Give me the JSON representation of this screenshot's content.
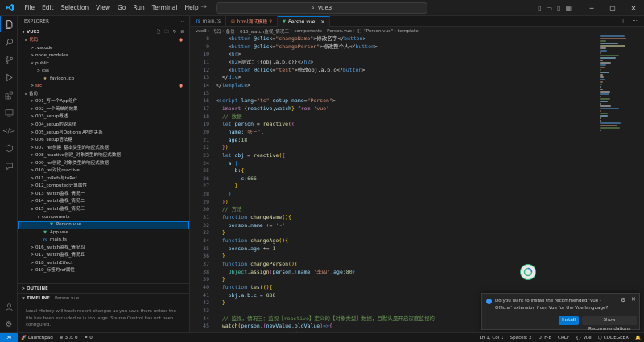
{
  "menu": [
    "File",
    "Edit",
    "Selection",
    "View",
    "Go",
    "Run",
    "Terminal",
    "Help"
  ],
  "search": {
    "text": "Vue3"
  },
  "sidebar": {
    "header": "EXPLORER",
    "root": "VUE3",
    "items": [
      {
        "label": "代码",
        "depth": 1,
        "chev": "v",
        "icon": "",
        "red": true
      },
      {
        "label": ".vscode",
        "depth": 2,
        "chev": ">",
        "icon": ""
      },
      {
        "label": "node_modules",
        "depth": 2,
        "chev": ">",
        "icon": ""
      },
      {
        "label": "public",
        "depth": 2,
        "chev": "v",
        "icon": ""
      },
      {
        "label": "css",
        "depth": 3,
        "chev": ">",
        "icon": ""
      },
      {
        "label": "favicon.ico",
        "depth": 3,
        "chev": "",
        "icon": "ico"
      },
      {
        "label": "src",
        "depth": 2,
        "chev": ">",
        "icon": "",
        "red": true
      },
      {
        "label": "备份",
        "depth": 1,
        "chev": "v",
        "icon": ""
      },
      {
        "label": "001_写一个App组件",
        "depth": 2,
        "chev": ">",
        "icon": ""
      },
      {
        "label": "002_一个简单的效果",
        "depth": 2,
        "chev": ">",
        "icon": ""
      },
      {
        "label": "003_setup概述",
        "depth": 2,
        "chev": ">",
        "icon": ""
      },
      {
        "label": "004_setup的返回值",
        "depth": 2,
        "chev": ">",
        "icon": ""
      },
      {
        "label": "005_setup与Options API的关系",
        "depth": 2,
        "chev": ">",
        "icon": ""
      },
      {
        "label": "006_setup语法糖",
        "depth": 2,
        "chev": ">",
        "icon": ""
      },
      {
        "label": "007_ref创建_基本类型的响应式数据",
        "depth": 2,
        "chev": ">",
        "icon": ""
      },
      {
        "label": "008_reactive创建_对象类型的响应式数据",
        "depth": 2,
        "chev": ">",
        "icon": ""
      },
      {
        "label": "009_ref创建_对象类型的响应式数据",
        "depth": 2,
        "chev": ">",
        "icon": ""
      },
      {
        "label": "010_ref对比reactive",
        "depth": 2,
        "chev": ">",
        "icon": ""
      },
      {
        "label": "011_toRefs与toRef",
        "depth": 2,
        "chev": ">",
        "icon": ""
      },
      {
        "label": "012_computed计算属性",
        "depth": 2,
        "chev": ">",
        "icon": ""
      },
      {
        "label": "013_watch监视_情况一",
        "depth": 2,
        "chev": ">",
        "icon": ""
      },
      {
        "label": "014_watch监视_情况二",
        "depth": 2,
        "chev": ">",
        "icon": ""
      },
      {
        "label": "015_watch监视_情况三",
        "depth": 2,
        "chev": "v",
        "icon": ""
      },
      {
        "label": "components",
        "depth": 3,
        "chev": "v",
        "icon": ""
      },
      {
        "label": "Person.vue",
        "depth": 4,
        "chev": "",
        "icon": "vue",
        "selected": true
      },
      {
        "label": "App.vue",
        "depth": 3,
        "chev": "",
        "icon": "vue"
      },
      {
        "label": "main.ts",
        "depth": 3,
        "chev": "",
        "icon": "ts"
      },
      {
        "label": "016_watch监视_情况四",
        "depth": 2,
        "chev": ">",
        "icon": ""
      },
      {
        "label": "017_watch监视_情况五",
        "depth": 2,
        "chev": ">",
        "icon": ""
      },
      {
        "label": "018_watchEffect",
        "depth": 2,
        "chev": ">",
        "icon": ""
      },
      {
        "label": "019_标签的ref属性",
        "depth": 2,
        "chev": ">",
        "icon": ""
      }
    ],
    "outline": "OUTLINE",
    "timeline": "TIMELINE",
    "timeline_file": "Person.vue",
    "timeline_text": "Local History will track recent changes as you save them unless the file has been excluded or is too large. Source Control has not been configured."
  },
  "tabs": [
    {
      "label": "main.ts",
      "icon": "TS",
      "active": false
    },
    {
      "label": "html测试模板 2",
      "icon": "",
      "active": false,
      "red": true
    },
    {
      "label": "Person.vue",
      "icon": "V",
      "active": true
    }
  ],
  "breadcrumb": [
    "vue3",
    "代码",
    "备份",
    "015_watch监视_情况三",
    "components",
    "Person.vue",
    "{} \"Person.vue\"",
    "template"
  ],
  "code_lines": [
    {
      "n": "8",
      "html": "    <span class='k-punc'>&lt;</span><span class='k-tag'>button</span> <span class='k-attr'>@click</span>=<span class='k-str'>\"changeName\"</span><span class='k-punc'>&gt;</span>修改名字<span class='k-punc'>&lt;/</span><span class='k-tag'>button</span><span class='k-punc'>&gt;</span>"
    },
    {
      "n": "9",
      "html": "    <span class='k-punc'>&lt;</span><span class='k-tag'>button</span> <span class='k-attr'>@click</span>=<span class='k-str'>\"changePerson\"</span><span class='k-punc'>&gt;</span>修改整个人<span class='k-punc'>&lt;/</span><span class='k-tag'>button</span><span class='k-punc'>&gt;</span>"
    },
    {
      "n": "10",
      "html": "    <span class='k-punc'>&lt;</span><span class='k-tag'>hr</span><span class='k-punc'>&gt;</span>"
    },
    {
      "n": "11",
      "html": "    <span class='k-punc'>&lt;</span><span class='k-tag'>h2</span><span class='k-punc'>&gt;</span>测试：{{obj.a.b.c}}<span class='k-punc'>&lt;/</span><span class='k-tag'>h2</span><span class='k-punc'>&gt;</span>"
    },
    {
      "n": "12",
      "html": "    <span class='k-punc'>&lt;</span><span class='k-tag'>button</span> <span class='k-attr'>@click</span>=<span class='k-str'>\"test\"</span><span class='k-punc'>&gt;</span>修改obj.a.b.c<span class='k-punc'>&lt;/</span><span class='k-tag'>button</span><span class='k-punc'>&gt;</span>"
    },
    {
      "n": "13",
      "html": "  <span class='k-punc'>&lt;/</span><span class='k-tag'>div</span><span class='k-punc'>&gt;</span>"
    },
    {
      "n": "14",
      "html": "<span class='k-punc'>&lt;/</span><span class='k-tag'>template</span><span class='k-punc'>&gt;</span>"
    },
    {
      "n": "15",
      "html": ""
    },
    {
      "n": "16",
      "html": "<span class='k-punc'>&lt;</span><span class='k-tag'>script</span> <span class='k-attr'>lang</span>=<span class='k-str'>\"ts\"</span> <span class='k-attr'>setup</span> <span class='k-attr'>name</span>=<span class='k-str'>\"Person\"</span><span class='k-punc'>&gt;</span>"
    },
    {
      "n": "17",
      "html": "  <span class='k-ctl'>import</span> <span class='k-br1'>{</span><span class='k-var'>reactive</span>,<span class='k-var'>watch</span><span class='k-br1'>}</span> <span class='k-ctl'>from</span> <span class='k-str'>'vue'</span>"
    },
    {
      "n": "18",
      "html": "  <span class='k-cmt'>// 数据</span>"
    },
    {
      "n": "19",
      "html": "  <span class='k-kw'>let</span> <span class='k-var'>person</span> = <span class='k-fn'>reactive</span><span class='k-br1'>(</span><span class='k-br2'>{</span>"
    },
    {
      "n": "20",
      "html": "    <span class='k-var'>name</span>:<span class='k-str'>'张三'</span>,"
    },
    {
      "n": "21",
      "html": "    <span class='k-var'>age</span>:<span class='k-num'>18</span>"
    },
    {
      "n": "22",
      "html": "  <span class='k-br2'>}</span><span class='k-br1'>)</span>"
    },
    {
      "n": "23",
      "html": "  <span class='k-kw'>let</span> <span class='k-var'>obj</span> = <span class='k-fn'>reactive</span><span class='k-br1'>(</span><span class='k-br2'>{</span>"
    },
    {
      "n": "24",
      "html": "    <span class='k-var'>a</span>:<span class='k-br3'>{</span>"
    },
    {
      "n": "25",
      "html": "      <span class='k-var'>b</span>:<span class='k-br1'>{</span>"
    },
    {
      "n": "26",
      "html": "        <span class='k-var'>c</span>:<span class='k-num'>666</span>"
    },
    {
      "n": "27",
      "html": "      <span class='k-br1'>}</span>"
    },
    {
      "n": "28",
      "html": "    <span class='k-br3'>}</span>"
    },
    {
      "n": "29",
      "html": "  <span class='k-br2'>}</span><span class='k-br1'>)</span>"
    },
    {
      "n": "30",
      "html": "  <span class='k-cmt'>// 方法</span>"
    },
    {
      "n": "31",
      "html": "  <span class='k-kw'>function</span> <span class='k-fn'>changeName</span><span class='k-br1'>()</span><span class='k-br1'>{</span>"
    },
    {
      "n": "32",
      "html": "    <span class='k-var'>person</span>.<span class='k-var'>name</span> += <span class='k-str'>'~'</span>"
    },
    {
      "n": "33",
      "html": "  <span class='k-br1'>}</span>"
    },
    {
      "n": "34",
      "html": "  <span class='k-kw'>function</span> <span class='k-fn'>changeAge</span><span class='k-br1'>()</span><span class='k-br1'>{</span>"
    },
    {
      "n": "35",
      "html": "    <span class='k-var'>person</span>.<span class='k-var'>age</span> += <span class='k-num'>1</span>"
    },
    {
      "n": "36",
      "html": "  <span class='k-br1'>}</span>"
    },
    {
      "n": "37",
      "html": "  <span class='k-kw'>function</span> <span class='k-fn'>changePerson</span><span class='k-br1'>()</span><span class='k-br1'>{</span>"
    },
    {
      "n": "38",
      "html": "    <span class='k-type'>Object</span>.<span class='k-fn'>assign</span><span class='k-br2'>(</span><span class='k-var'>person</span>,<span class='k-br3'>{</span><span class='k-var'>name</span>:<span class='k-str'>'李四'</span>,<span class='k-var'>age</span>:<span class='k-num'>80</span><span class='k-br3'>}</span><span class='k-br2'>)</span>"
    },
    {
      "n": "39",
      "html": "  <span class='k-br1'>}</span>"
    },
    {
      "n": "40",
      "html": "  <span class='k-kw'>function</span> <span class='k-fn'>test</span><span class='k-br1'>()</span><span class='k-br1'>{</span>"
    },
    {
      "n": "41",
      "html": "    <span class='k-var'>obj</span>.<span class='k-var'>a</span>.<span class='k-var'>b</span>.<span class='k-var'>c</span> = <span class='k-num'>888</span>"
    },
    {
      "n": "42",
      "html": "  <span class='k-br1'>}</span>"
    },
    {
      "n": "43",
      "html": ""
    },
    {
      "n": "44",
      "html": "  <span class='k-cmt'>// 监视，情况三：监视【reactive】定义的【对象类型】数据，且默认是开启深度监视的</span>"
    },
    {
      "n": "45",
      "html": "  <span class='k-fn'>watch</span><span class='k-br1'>(</span><span class='k-var'>person</span>,<span class='k-br2'>(</span><span class='k-var'>newValue</span>,<span class='k-var'>oldValue</span><span class='k-br2'>)</span><span class='k-kw'>=&gt;</span><span class='k-br2'>{</span>"
    },
    {
      "n": "46",
      "html": "    <span class='k-var'>console</span>.<span class='k-fn'>log</span><span class='k-br3'>(</span><span class='k-str'>'person变化了'</span>,<span class='k-var'>newValue</span>,<span class='k-var'>oldValue</span><span class='k-br3'>)</span>"
    },
    {
      "n": "47",
      "html": "  <span class='k-br2'>}</span><span class='k-br1'>)</span>"
    }
  ],
  "notification": {
    "message": "Do you want to install the recommended 'Vue - Official' extension from Vue for the Vue language?",
    "install": "Install",
    "recommendations": "Show Recommendations"
  },
  "status": {
    "launchpad": "Launchpad",
    "errors": "3",
    "warnings": "0",
    "ports": "0",
    "position": "Ln 1, Col 1",
    "spaces": "Spaces: 2",
    "encoding": "UTF-8",
    "eol": "CRLF",
    "language": "Vue",
    "codegeex": "CODEGEEX"
  },
  "colors": {
    "accent": "#0078d4",
    "vue": "#41b883",
    "selection": "#04395e"
  }
}
